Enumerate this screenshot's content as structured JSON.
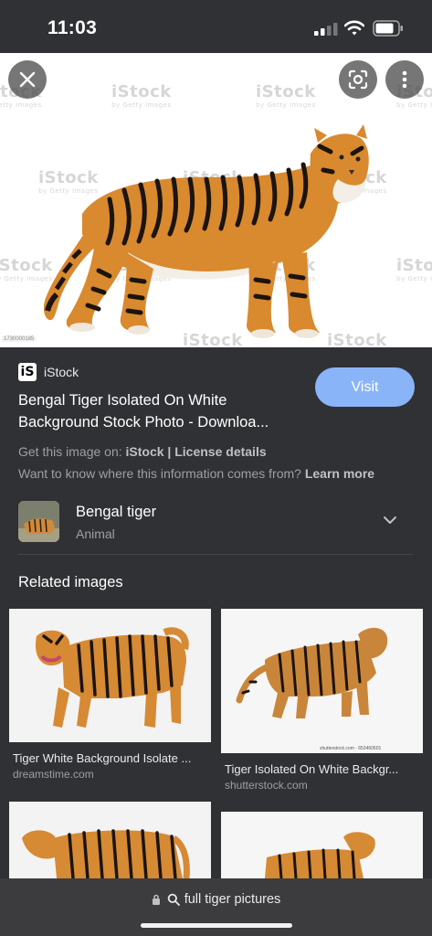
{
  "status_bar": {
    "time": "11:03"
  },
  "hero": {
    "watermark": "iStock",
    "watermark_sub": "by Getty Images",
    "image_id": "1730000185"
  },
  "result": {
    "source_logo_text": "iS",
    "source_name": "iStock",
    "title": "Bengal Tiger Isolated On White Background Stock Photo - Downloa...",
    "visit_label": "Visit",
    "get_prefix": "Get this image on:",
    "get_source": "iStock",
    "get_sep": "|",
    "license": "License details",
    "know_text": "Want to know where this information comes from?",
    "learn_more": "Learn more"
  },
  "entity": {
    "name": "Bengal tiger",
    "type": "Animal"
  },
  "related": {
    "heading": "Related images",
    "items": [
      {
        "title": "Tiger White Background Isolate ...",
        "source": "dreamstime.com"
      },
      {
        "title": "Tiger Isolated On White Backgr...",
        "source": "shutterstock.com",
        "stamp": "shutterstock.com · 653460601"
      },
      {
        "title": "",
        "source": ""
      },
      {
        "title": "",
        "source": ""
      }
    ]
  },
  "address_bar": {
    "url": "full tiger pictures"
  },
  "colors": {
    "background": "#303134",
    "accent": "#8ab4f8",
    "tiger_orange": "#d9892e"
  },
  "icons": [
    "signal-icon",
    "wifi-icon",
    "battery-icon",
    "close-icon",
    "lens-icon",
    "more-vert-icon",
    "chevron-down-icon",
    "lock-icon",
    "search-icon"
  ]
}
